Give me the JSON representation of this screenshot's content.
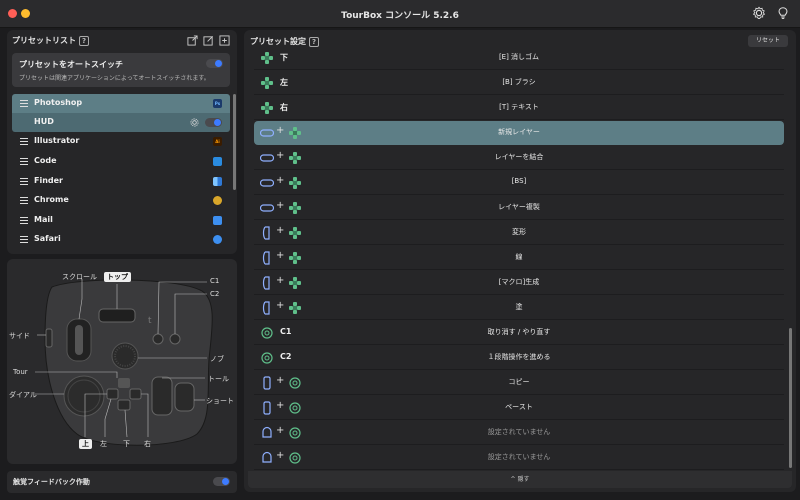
{
  "window": {
    "title": "TourBox コンソール 5.2.6"
  },
  "preset_list": {
    "title": "プリセットリスト",
    "help": "?",
    "auto_switch": {
      "title": "プリセットをオートスイッチ",
      "subtitle": "プリセットは関連アプリケーションによってオートスイッチされます。"
    },
    "apps": [
      {
        "name": "Photoshop",
        "badge": "Ps",
        "color": "#1b3a6b"
      },
      {
        "name": "HUD",
        "badge": "",
        "color": ""
      },
      {
        "name": "Illustrator",
        "badge": "Ai",
        "color": "#3a1c00"
      },
      {
        "name": "Code",
        "badge": "",
        "color": "#2a8be0"
      },
      {
        "name": "Finder",
        "badge": "",
        "color": "#3b8de0"
      },
      {
        "name": "Chrome",
        "badge": "",
        "color": "#d9a62a"
      },
      {
        "name": "Mail",
        "badge": "",
        "color": "#3d8ff0"
      },
      {
        "name": "Safari",
        "badge": "",
        "color": "#3d8ff0"
      }
    ]
  },
  "device": {
    "labels": {
      "scroll": "スクロール",
      "top": "トップ",
      "c1": "C1",
      "c2": "C2",
      "side": "サイド",
      "knob": "ノブ",
      "tour": "Tour",
      "tall": "トール",
      "dial": "ダイアル",
      "short": "ショート",
      "up": "上",
      "left": "左",
      "down": "下",
      "right": "右"
    }
  },
  "haptic": {
    "label": "触覚フィードバック作動"
  },
  "preset_settings": {
    "title": "プリセット設定",
    "help": "?",
    "reset": "リセット",
    "rows": [
      {
        "icon1": "dpad",
        "dir": "下",
        "action": "[E] 消しゴム"
      },
      {
        "icon1": "dpad",
        "dir": "左",
        "action": "[B] ブラシ"
      },
      {
        "icon1": "dpad",
        "dir": "右",
        "action": "[T] テキスト"
      },
      {
        "icon1": "tall",
        "icon2": "dpad",
        "action": "新規レイヤー"
      },
      {
        "icon1": "tall",
        "icon2": "dpad",
        "action": "レイヤーを結合"
      },
      {
        "icon1": "tall",
        "icon2": "dpad",
        "action": "[BS]"
      },
      {
        "icon1": "tall",
        "icon2": "dpad",
        "action": "レイヤー複製"
      },
      {
        "icon1": "side",
        "icon2": "dpad",
        "action": "変形"
      },
      {
        "icon1": "side",
        "icon2": "dpad",
        "action": "線"
      },
      {
        "icon1": "side",
        "icon2": "dpad",
        "action": "[マクロ]生成"
      },
      {
        "icon1": "side",
        "icon2": "dpad",
        "action": "塗"
      },
      {
        "icon1": "c",
        "dir": "C1",
        "action": "取り消す / やり直す"
      },
      {
        "icon1": "c",
        "dir": "C2",
        "action": "１段階操作を進める"
      },
      {
        "icon1": "phone",
        "icon2": "c",
        "action": "コピー"
      },
      {
        "icon1": "phone",
        "icon2": "c",
        "action": "ペースト"
      },
      {
        "icon1": "bell",
        "icon2": "c",
        "action": "設定されていません"
      },
      {
        "icon1": "bell",
        "icon2": "c",
        "action": "設定されていません"
      }
    ],
    "hide": "^  隠す"
  }
}
